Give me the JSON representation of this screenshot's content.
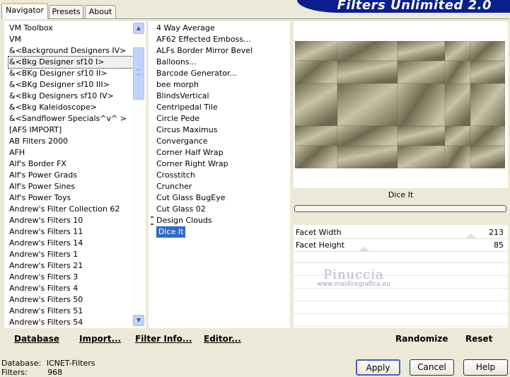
{
  "tabs": [
    {
      "label": "Navigator",
      "active": true
    },
    {
      "label": "Presets",
      "active": false
    },
    {
      "label": "About",
      "active": false
    }
  ],
  "banner": {
    "text": "Filters Unlimited 2.0",
    "color": "#0a1e8c"
  },
  "categories": [
    "VM Toolbox",
    "VM",
    "&<Background Designers IV>",
    "&<Bkg Designer sf10 I>",
    "&<BKg Designer sf10 II>",
    "&<BKg Designer sf10 III>",
    "&<Bkg Designers sf10 IV>",
    "&<Bkg Kaleidoscope>",
    "&<Sandflower Specials^v^ >",
    "[AFS IMPORT]",
    "AB Filters 2000",
    "AFH",
    "Alf's Border FX",
    "Alf's Power Grads",
    "Alf's Power Sines",
    "Alf's Power Toys",
    "Andrew's Filter Collection 62",
    "Andrew's Filters 10",
    "Andrew's Filters 11",
    "Andrew's Filters 14",
    "Andrew's Filters 1",
    "Andrew's Filters 21",
    "Andrew's Filters 3",
    "Andrew's Filters 4",
    "Andrew's Filters 50",
    "Andrew's Filters 51",
    "Andrew's Filters 54"
  ],
  "selected_category": "&<Bkg Designer sf10 I>",
  "filters": [
    "4 Way Average",
    "AF62 Effected Emboss...",
    "ALFs Border Mirror Bevel",
    "Balloons...",
    "Barcode Generator...",
    "bee morph",
    "BlindsVertical",
    "Centripedal Tile",
    "Circle Pede",
    "Circus Maximus",
    "Convergance",
    "Corner Half Wrap",
    "Corner Right Wrap",
    "Crosstitch",
    "Cruncher",
    "Cut Glass  BugEye",
    "Cut Glass 02",
    "Design Clouds",
    "Dice It"
  ],
  "selected_filter": "Dice It",
  "preview": {
    "filter_name": "Dice It",
    "tone_light": "#c8c3a6",
    "tone_dark": "#6e6a4f"
  },
  "params": [
    {
      "label": "Facet Width",
      "value": "213",
      "fraction": 0.83
    },
    {
      "label": "Facet Height",
      "value": "85",
      "fraction": 0.33
    }
  ],
  "watermark": {
    "name": "Pinuccia",
    "site": "www.maidiregrafica.eu"
  },
  "left_buttons": [
    {
      "label": "Database"
    },
    {
      "label": "Import..."
    },
    {
      "label": "Filter Info..."
    },
    {
      "label": "Editor..."
    }
  ],
  "right_buttons": [
    {
      "label": "Randomize"
    },
    {
      "label": "Reset"
    }
  ],
  "status": {
    "database_label": "Database:",
    "database_value": "ICNET-Filters",
    "filters_label": "Filters:",
    "filters_value": "968"
  },
  "dialog_buttons": [
    {
      "label": "Apply"
    },
    {
      "label": "Cancel"
    },
    {
      "label": "Help"
    }
  ]
}
